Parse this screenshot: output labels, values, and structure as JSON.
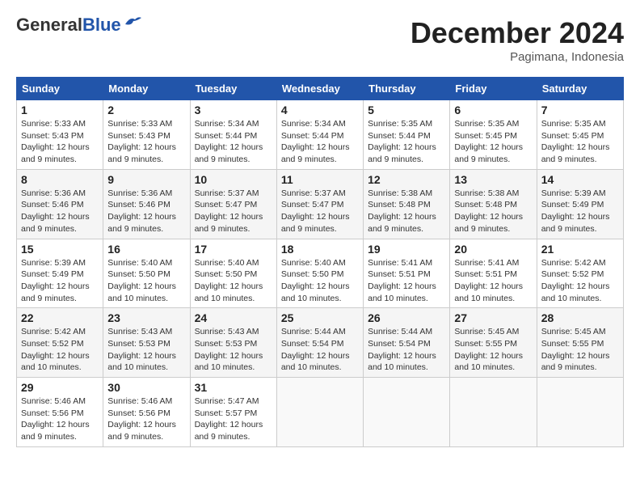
{
  "header": {
    "logo_general": "General",
    "logo_blue": "Blue",
    "month": "December 2024",
    "location": "Pagimana, Indonesia"
  },
  "days_of_week": [
    "Sunday",
    "Monday",
    "Tuesday",
    "Wednesday",
    "Thursday",
    "Friday",
    "Saturday"
  ],
  "weeks": [
    [
      {
        "day": "1",
        "info": "Sunrise: 5:33 AM\nSunset: 5:43 PM\nDaylight: 12 hours\nand 9 minutes."
      },
      {
        "day": "2",
        "info": "Sunrise: 5:33 AM\nSunset: 5:43 PM\nDaylight: 12 hours\nand 9 minutes."
      },
      {
        "day": "3",
        "info": "Sunrise: 5:34 AM\nSunset: 5:44 PM\nDaylight: 12 hours\nand 9 minutes."
      },
      {
        "day": "4",
        "info": "Sunrise: 5:34 AM\nSunset: 5:44 PM\nDaylight: 12 hours\nand 9 minutes."
      },
      {
        "day": "5",
        "info": "Sunrise: 5:35 AM\nSunset: 5:44 PM\nDaylight: 12 hours\nand 9 minutes."
      },
      {
        "day": "6",
        "info": "Sunrise: 5:35 AM\nSunset: 5:45 PM\nDaylight: 12 hours\nand 9 minutes."
      },
      {
        "day": "7",
        "info": "Sunrise: 5:35 AM\nSunset: 5:45 PM\nDaylight: 12 hours\nand 9 minutes."
      }
    ],
    [
      {
        "day": "8",
        "info": "Sunrise: 5:36 AM\nSunset: 5:46 PM\nDaylight: 12 hours\nand 9 minutes."
      },
      {
        "day": "9",
        "info": "Sunrise: 5:36 AM\nSunset: 5:46 PM\nDaylight: 12 hours\nand 9 minutes."
      },
      {
        "day": "10",
        "info": "Sunrise: 5:37 AM\nSunset: 5:47 PM\nDaylight: 12 hours\nand 9 minutes."
      },
      {
        "day": "11",
        "info": "Sunrise: 5:37 AM\nSunset: 5:47 PM\nDaylight: 12 hours\nand 9 minutes."
      },
      {
        "day": "12",
        "info": "Sunrise: 5:38 AM\nSunset: 5:48 PM\nDaylight: 12 hours\nand 9 minutes."
      },
      {
        "day": "13",
        "info": "Sunrise: 5:38 AM\nSunset: 5:48 PM\nDaylight: 12 hours\nand 9 minutes."
      },
      {
        "day": "14",
        "info": "Sunrise: 5:39 AM\nSunset: 5:49 PM\nDaylight: 12 hours\nand 9 minutes."
      }
    ],
    [
      {
        "day": "15",
        "info": "Sunrise: 5:39 AM\nSunset: 5:49 PM\nDaylight: 12 hours\nand 9 minutes."
      },
      {
        "day": "16",
        "info": "Sunrise: 5:40 AM\nSunset: 5:50 PM\nDaylight: 12 hours\nand 10 minutes."
      },
      {
        "day": "17",
        "info": "Sunrise: 5:40 AM\nSunset: 5:50 PM\nDaylight: 12 hours\nand 10 minutes."
      },
      {
        "day": "18",
        "info": "Sunrise: 5:40 AM\nSunset: 5:50 PM\nDaylight: 12 hours\nand 10 minutes."
      },
      {
        "day": "19",
        "info": "Sunrise: 5:41 AM\nSunset: 5:51 PM\nDaylight: 12 hours\nand 10 minutes."
      },
      {
        "day": "20",
        "info": "Sunrise: 5:41 AM\nSunset: 5:51 PM\nDaylight: 12 hours\nand 10 minutes."
      },
      {
        "day": "21",
        "info": "Sunrise: 5:42 AM\nSunset: 5:52 PM\nDaylight: 12 hours\nand 10 minutes."
      }
    ],
    [
      {
        "day": "22",
        "info": "Sunrise: 5:42 AM\nSunset: 5:52 PM\nDaylight: 12 hours\nand 10 minutes."
      },
      {
        "day": "23",
        "info": "Sunrise: 5:43 AM\nSunset: 5:53 PM\nDaylight: 12 hours\nand 10 minutes."
      },
      {
        "day": "24",
        "info": "Sunrise: 5:43 AM\nSunset: 5:53 PM\nDaylight: 12 hours\nand 10 minutes."
      },
      {
        "day": "25",
        "info": "Sunrise: 5:44 AM\nSunset: 5:54 PM\nDaylight: 12 hours\nand 10 minutes."
      },
      {
        "day": "26",
        "info": "Sunrise: 5:44 AM\nSunset: 5:54 PM\nDaylight: 12 hours\nand 10 minutes."
      },
      {
        "day": "27",
        "info": "Sunrise: 5:45 AM\nSunset: 5:55 PM\nDaylight: 12 hours\nand 10 minutes."
      },
      {
        "day": "28",
        "info": "Sunrise: 5:45 AM\nSunset: 5:55 PM\nDaylight: 12 hours\nand 9 minutes."
      }
    ],
    [
      {
        "day": "29",
        "info": "Sunrise: 5:46 AM\nSunset: 5:56 PM\nDaylight: 12 hours\nand 9 minutes."
      },
      {
        "day": "30",
        "info": "Sunrise: 5:46 AM\nSunset: 5:56 PM\nDaylight: 12 hours\nand 9 minutes."
      },
      {
        "day": "31",
        "info": "Sunrise: 5:47 AM\nSunset: 5:57 PM\nDaylight: 12 hours\nand 9 minutes."
      },
      null,
      null,
      null,
      null
    ]
  ]
}
